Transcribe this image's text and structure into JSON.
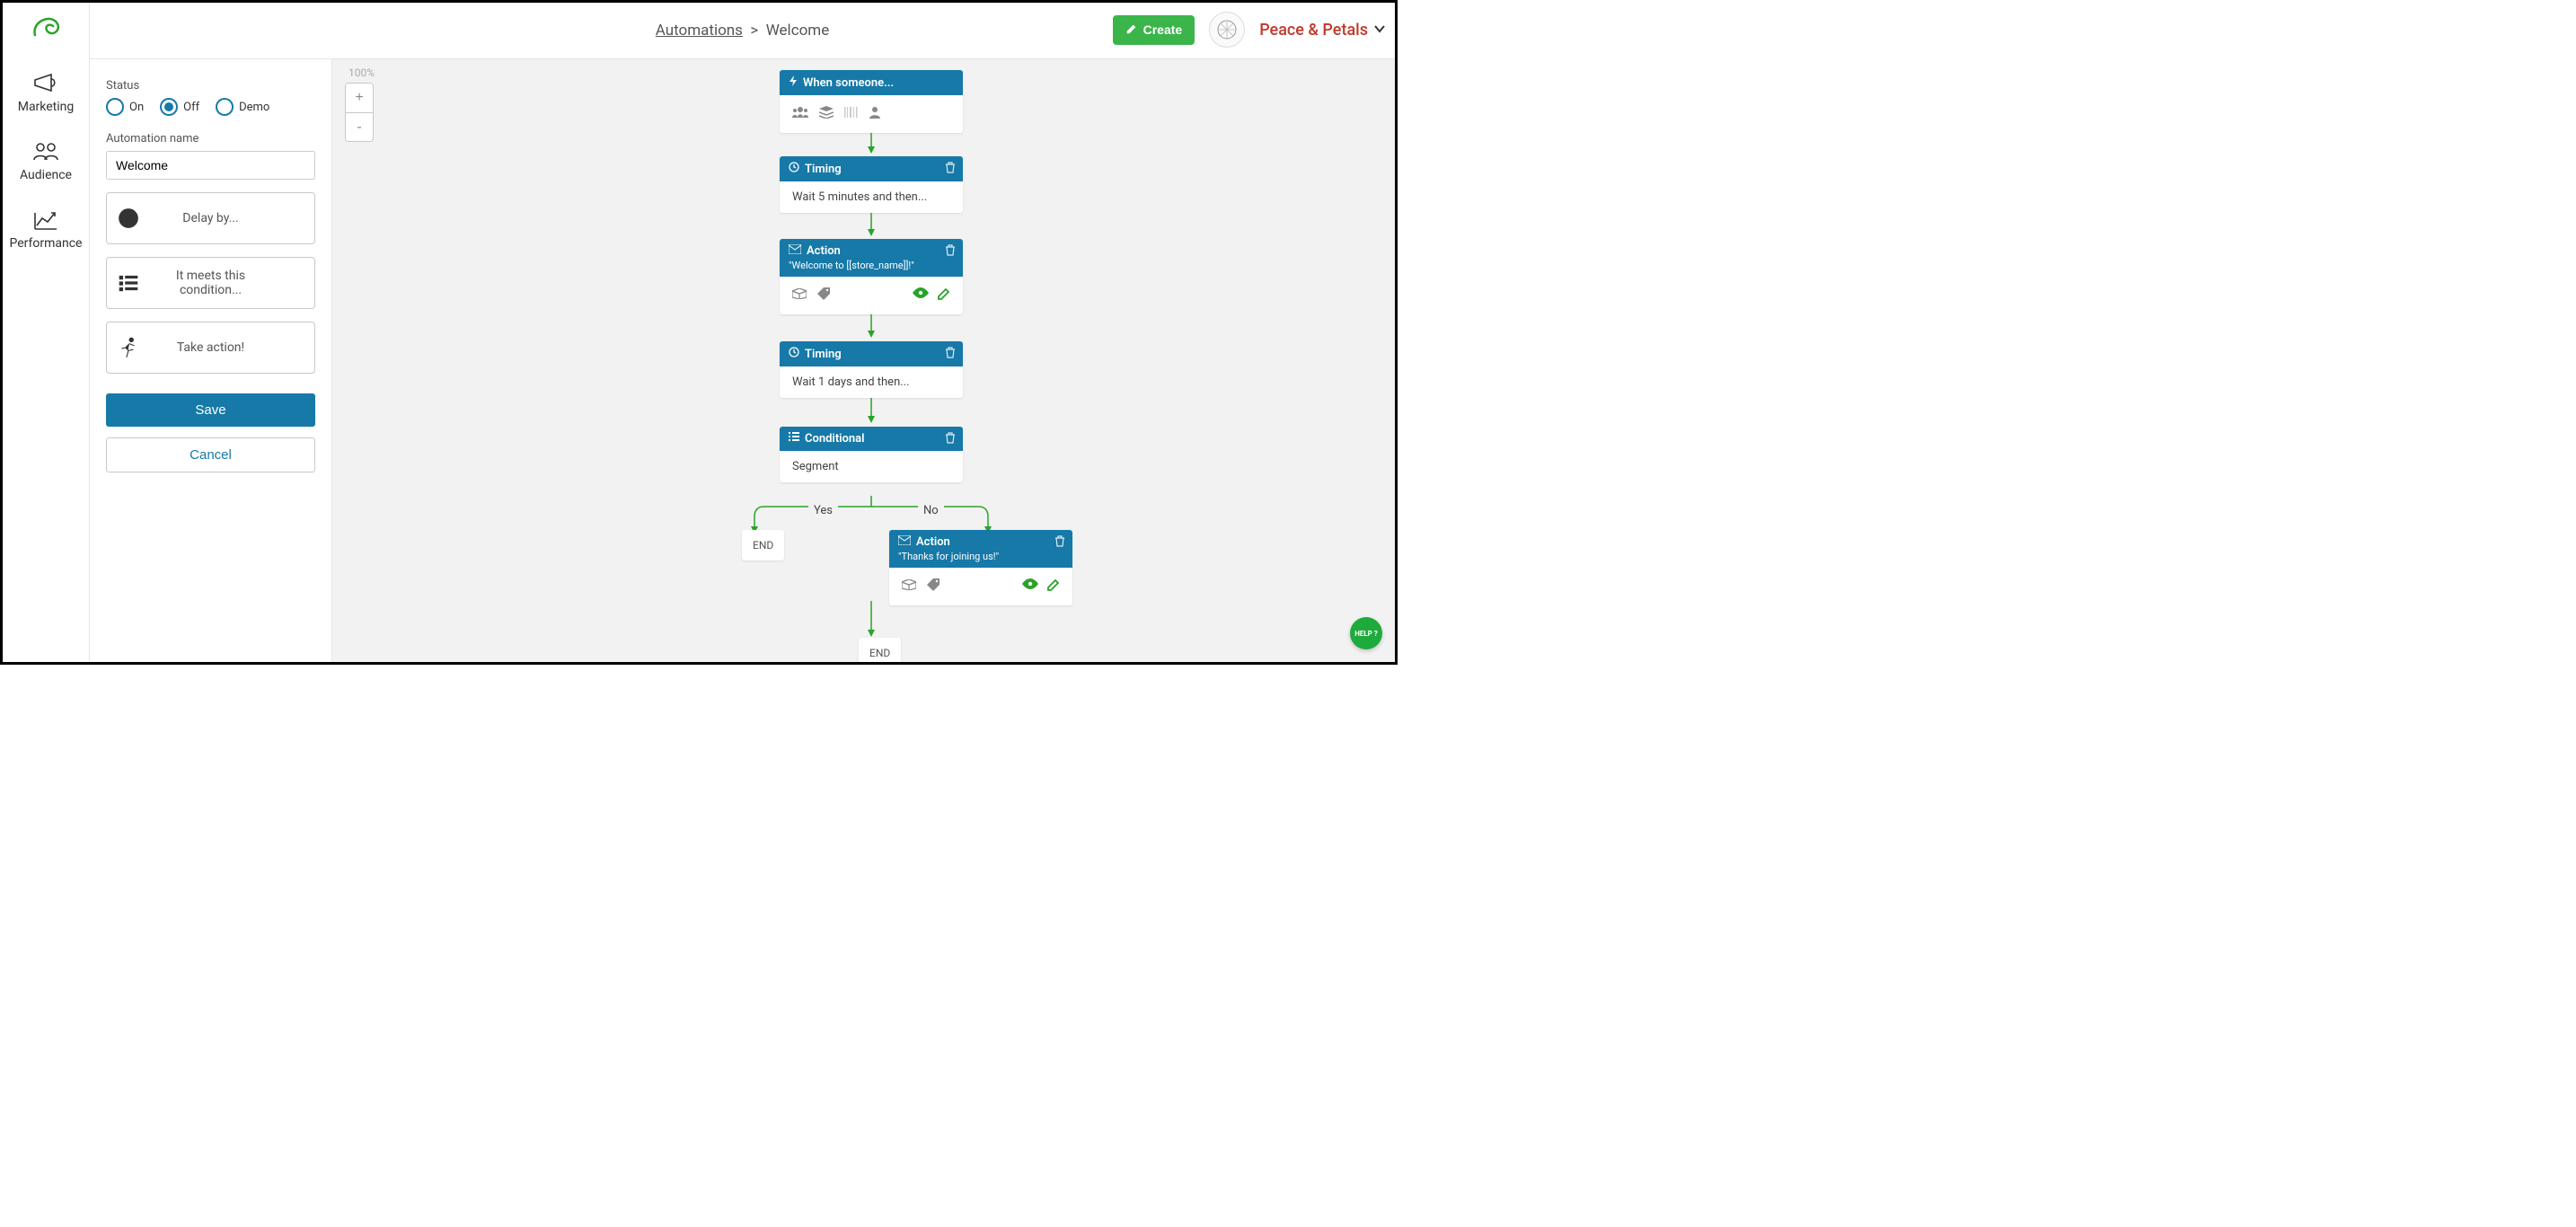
{
  "breadcrumb": {
    "parent": "Automations",
    "sep": ">",
    "current": "Welcome"
  },
  "top": {
    "create": "Create",
    "brand": "Peace & Petals"
  },
  "nav": {
    "marketing": "Marketing",
    "audience": "Audience",
    "performance": "Performance"
  },
  "sidebar": {
    "status_label": "Status",
    "opt_on": "On",
    "opt_off": "Off",
    "opt_demo": "Demo",
    "name_label": "Automation name",
    "name_value": "Welcome",
    "delay": "Delay by...",
    "condition": "It meets this condition...",
    "action": "Take action!",
    "save": "Save",
    "cancel": "Cancel"
  },
  "canvas": {
    "zoom": "100%",
    "trigger_title": "When someone...",
    "timing1_title": "Timing",
    "timing1_body": "Wait 5 minutes and then...",
    "action1_title": "Action",
    "action1_sub": "\"Welcome to [[store_name]]!\"",
    "timing2_title": "Timing",
    "timing2_body": "Wait 1 days and then...",
    "cond_title": "Conditional",
    "cond_body": "Segment",
    "yes": "Yes",
    "no": "No",
    "end": "END",
    "action2_title": "Action",
    "action2_sub": "\"Thanks for joining us!\""
  },
  "help": "HELP ?"
}
